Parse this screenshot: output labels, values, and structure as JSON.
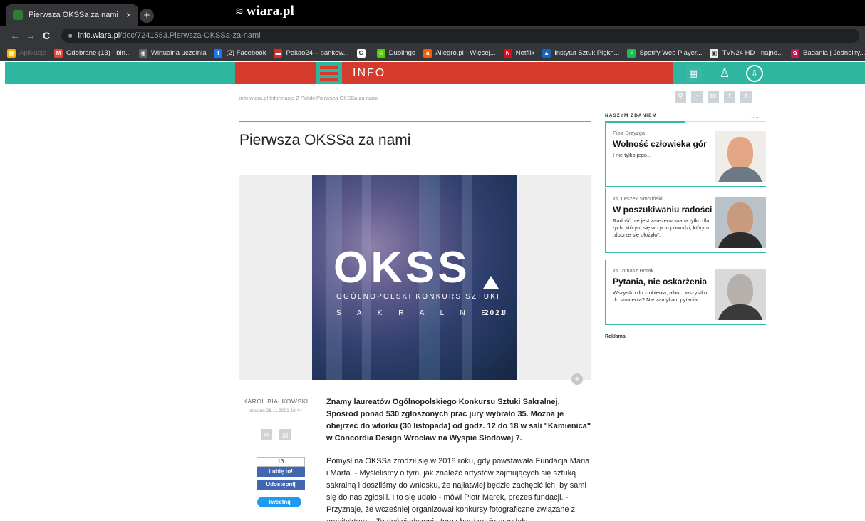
{
  "browser": {
    "tab_title": "Pierwsza OKSSa za nami",
    "tab_close": "×",
    "new_tab": "+",
    "url_host": "info.wiara.pl",
    "url_path": "/doc/7241583.Pierwsza-OKSSa-za-nami",
    "bookmarks": [
      {
        "label": "Aplikacje",
        "icon": "apps-grid-icon",
        "color": "#f4b400"
      },
      {
        "label": "Odebrane (13) - bin...",
        "icon": "gmail-icon",
        "color": "#ea4335"
      },
      {
        "label": "Wirtualna uczelnia",
        "icon": "globe-icon",
        "color": "#5f6368"
      },
      {
        "label": "(2) Facebook",
        "icon": "facebook-icon",
        "color": "#1877f2"
      },
      {
        "label": "Pekao24 – bankow...",
        "icon": "bank-icon",
        "color": "#d32f2f"
      },
      {
        "label": "",
        "icon": "google-icon",
        "color": "#ffffff"
      },
      {
        "label": "Duolingo",
        "icon": "duolingo-icon",
        "color": "#58cc02"
      },
      {
        "label": "Allegro.pl - Więcej...",
        "icon": "allegro-icon",
        "color": "#ff5a00"
      },
      {
        "label": "Netflix",
        "icon": "netflix-icon",
        "color": "#e50914"
      },
      {
        "label": "Instytut Sztuk Piękn...",
        "icon": "university-icon",
        "color": "#1565c0"
      },
      {
        "label": "Spotify Web Player...",
        "icon": "spotify-icon",
        "color": "#1db954"
      },
      {
        "label": "TVN24 HD - najno...",
        "icon": "tvn24-icon",
        "color": "#eeeeee"
      },
      {
        "label": "Badania | Jednolity...",
        "icon": "research-icon",
        "color": "#c2185b"
      }
    ]
  },
  "site": {
    "logo": "wiara.pl",
    "section": "INFO",
    "colors": {
      "teal": "#2eb6a0",
      "red": "#d53b2c"
    }
  },
  "breadcrumb": "info.wiara.pl Informacje Z Polski Pierwsza OKSSa za nami",
  "article": {
    "title": "Pierwsza OKSSa za nami",
    "poster": {
      "logo": "OKSS",
      "line1": "OGÓLNOPOLSKI KONKURS SZTUKI",
      "line2": "S A K R A L N E J",
      "year": "2021"
    },
    "author": "KAROL BIAŁKOWSKI",
    "added": "dodane 26.11.2021 18:44",
    "fb_count": "13",
    "fb_like": "Lubię to!",
    "fb_share": "Udostępnij",
    "tweet": "Tweetnij",
    "lead": "Znamy laureatów Ogólnopolskiego Konkursu Sztuki Sakralnej. Spośród ponad 530 zgłoszonych prac jury wybrało 35. Można je obejrzeć do wtorku (30 listopada) od godz. 12 do 18 w sali \"Kamienica\" w Concordia Design Wrocław na Wyspie Słodowej 7.",
    "body": "Pomysł na OKSSa zrodził się w 2018 roku, gdy powstawała Fundacja Maria i Marta. - Myśleliśmy o tym, jak znaleźć artystów zajmujących się sztuką sakralną i doszliśmy do wniosku, że najłatwiej będzie zachęcić ich, by sami się do nas zgłosili. I to się udało - mówi Piotr Marek, prezes fundacji. - Przyznaje, że wcześniej organizował konkursy fotograficzne związane z architekturą. - Te doświadczenia teraz bardzo się przydały."
  },
  "sidebar": {
    "heading": "NASZYM ZDANIEM",
    "more": ".....",
    "opinions": [
      {
        "author": "Piotr Drzyzga",
        "title": "Wolność człowieka gór",
        "desc": "I nie tylko jego..."
      },
      {
        "author": "ks. Leszek Smoliński",
        "title": "W poszukiwaniu radości",
        "desc": "Radość nie jest zarezerwowana tylko dla tych, którym się w życiu powodzi, którym „dobrze się ułożyło”."
      },
      {
        "author": "ks Tomasz Horak",
        "title": "Pytania, nie oskarżenia",
        "desc": "Wszystko do zrobienia, albo... wszystko do stracenia? Nie zamykam pytania."
      }
    ],
    "ad_label": "Reklama"
  }
}
